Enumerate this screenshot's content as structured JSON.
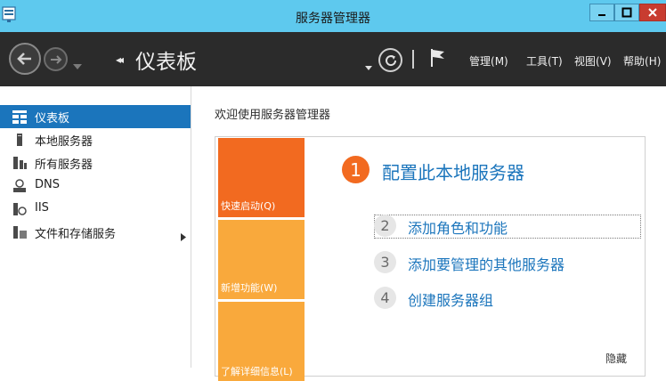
{
  "window": {
    "title": "服务器管理器"
  },
  "header": {
    "breadcrumb": "仪表板",
    "menus": [
      {
        "label": "管理",
        "key": "(M)"
      },
      {
        "label": "工具",
        "key": "(T)"
      },
      {
        "label": "视图",
        "key": "(V)"
      },
      {
        "label": "帮助",
        "key": "(H)"
      }
    ]
  },
  "sidebar": {
    "items": [
      {
        "label": "仪表板",
        "icon": "dashboard-icon",
        "active": true
      },
      {
        "label": "本地服务器",
        "icon": "local-server-icon"
      },
      {
        "label": "所有服务器",
        "icon": "all-servers-icon"
      },
      {
        "label": "DNS",
        "icon": "dns-icon"
      },
      {
        "label": "IIS",
        "icon": "iis-icon"
      },
      {
        "label": "文件和存储服务",
        "icon": "file-storage-icon",
        "has_submenu": true
      }
    ]
  },
  "main": {
    "welcome": "欢迎使用服务器管理器",
    "tiles": [
      {
        "label": "快速启动",
        "key": "(Q)",
        "color": "#f26a20"
      },
      {
        "label": "新增功能",
        "key": "(W)",
        "color": "#f9a93c"
      },
      {
        "label": "了解详细信息",
        "key": "(L)",
        "color": "#f9a93c"
      }
    ],
    "steps": [
      {
        "num": "1",
        "label": "配置此本地服务器"
      },
      {
        "num": "2",
        "label": "添加角色和功能"
      },
      {
        "num": "3",
        "label": "添加要管理的其他服务器"
      },
      {
        "num": "4",
        "label": "创建服务器组"
      }
    ],
    "hide": "隐藏"
  },
  "colors": {
    "titlebar": "#5ec9ee",
    "header": "#2b2b2b",
    "accent": "#1b75bc",
    "orange": "#f26a20",
    "light_orange": "#f9a93c"
  }
}
